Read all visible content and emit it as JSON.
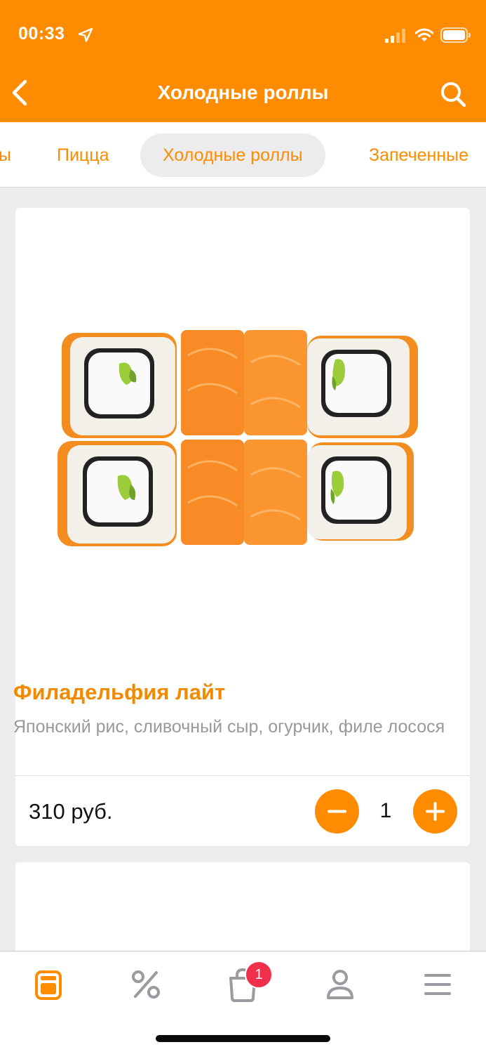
{
  "status_bar": {
    "time": "00:33"
  },
  "header": {
    "title": "Холодные роллы"
  },
  "category_tabs": [
    {
      "label": "ы"
    },
    {
      "label": "Пицца"
    },
    {
      "label": "Холодные роллы"
    },
    {
      "label": "Запеченные"
    }
  ],
  "product": {
    "name": "Филадельфия лайт",
    "description": "Японский рис, сливочный сыр, огурчик, филе лосося",
    "price": "310 руб.",
    "quantity": "1"
  },
  "tab_bar": {
    "cart_badge": "1",
    "items": [
      "menu-icon",
      "percent-icon",
      "cart-icon",
      "profile-icon",
      "hamburger-icon"
    ]
  },
  "colors": {
    "accent": "#ff8c00",
    "badge": "#f0304a",
    "inactive_icon": "#9a9aa0"
  }
}
